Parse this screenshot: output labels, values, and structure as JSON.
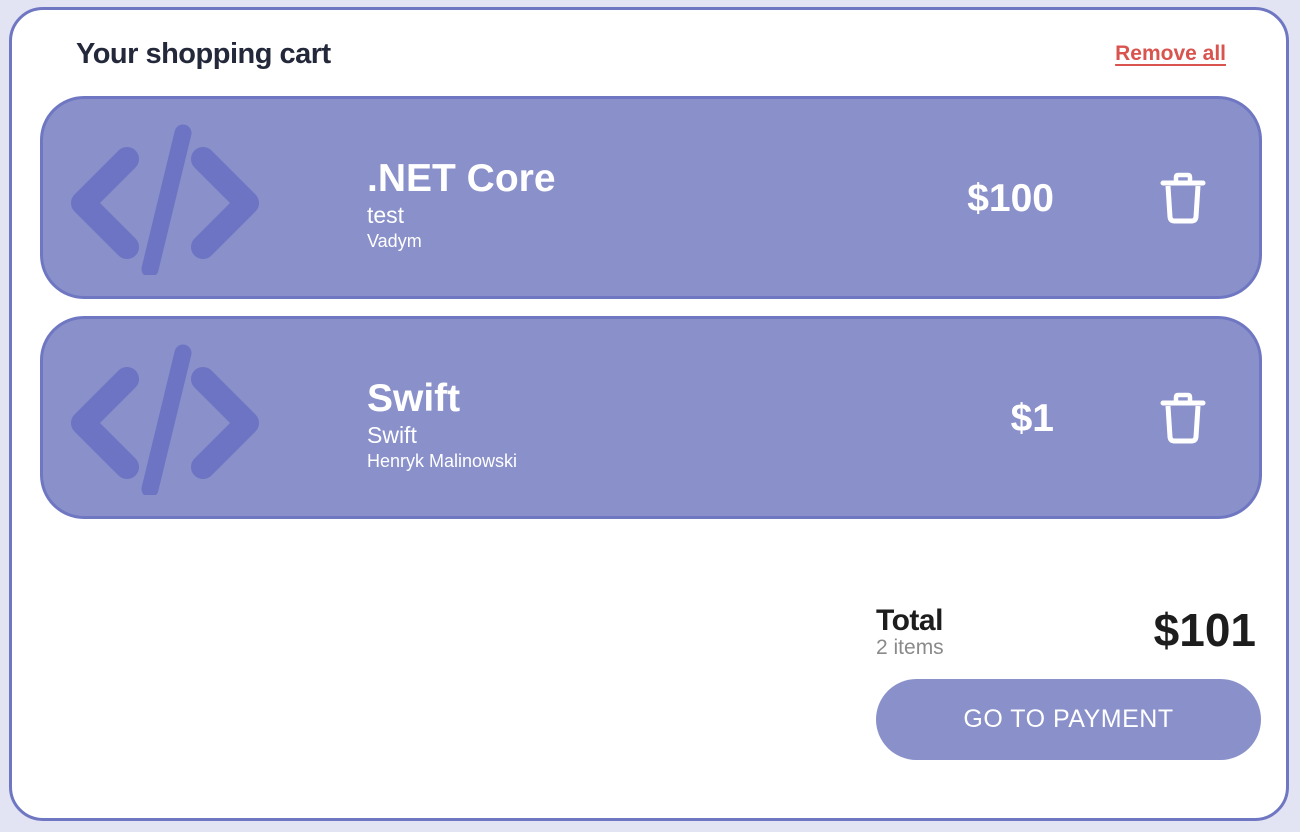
{
  "cart": {
    "title": "Your shopping cart",
    "remove_all_label": "Remove all"
  },
  "items": [
    {
      "icon": "code-icon",
      "title": ".NET Core",
      "subtitle": "test",
      "author": "Vadym",
      "price": "$100",
      "delete_icon": "trash-icon"
    },
    {
      "icon": "code-icon",
      "title": "Swift",
      "subtitle": "Swift",
      "author": "Henryk Malinowski",
      "price": "$1",
      "delete_icon": "trash-icon"
    }
  ],
  "summary": {
    "total_label": "Total",
    "item_count": "2 items",
    "total_amount": "$101",
    "pay_button_label": "GO TO PAYMENT"
  },
  "colors": {
    "accent": "#8990ca",
    "accent_border": "#6f77c2",
    "icon_shade": "#6c74c3",
    "remove": "#d9534f",
    "page_background": "#e2e3f3"
  }
}
